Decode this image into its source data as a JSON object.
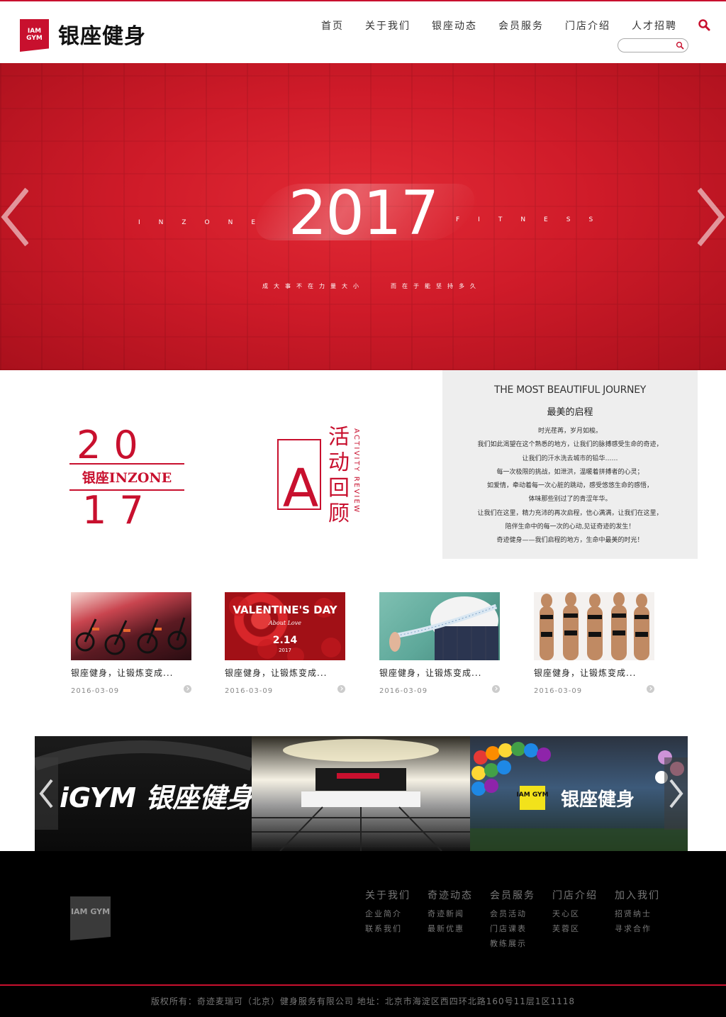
{
  "brand": {
    "name": "银座健身",
    "logo_mark": "IAM GYM",
    "accent": "#c8102e"
  },
  "nav": {
    "items": [
      "首页",
      "关于我们",
      "银座动态",
      "会员服务",
      "门店介绍",
      "人才招聘"
    ],
    "search_placeholder": ""
  },
  "banner": {
    "year": "2017",
    "left_word": "INZONE",
    "right_word": "FITNESS",
    "slogan_a": "成大事不在力量大小",
    "slogan_b": "而在于能坚持多久"
  },
  "features": {
    "logo_2017": {
      "top": "20",
      "bottom": "17",
      "label": "银座INZONE"
    },
    "activity": {
      "letter": "A",
      "chars": [
        "活",
        "动",
        "回",
        "顾"
      ],
      "vertical_en": "ACTIVITY REVIEW"
    }
  },
  "journey": {
    "title_en": "THE MOST BEAUTIFUL JOURNEY",
    "title_cn": "最美的启程",
    "lines": [
      "时光荏苒，岁月如梭。",
      "我们如此渴望在这个熟悉的地方，让我们的脉搏感受生命的奇迹，",
      "让我们的汗水洗去城市的铅华……",
      "每一次极限的挑战，如泄洪，温暖着拼搏者的心灵；",
      "如爱情，牵动着每一次心脏的跳动，感受悠悠生命的感悟，",
      "体味那些别过了的青涩年华。",
      "让我们在这里，精力充沛的再次启程，信心满满，让我们在这里，",
      "陪伴生命中的每一次的心动,见证奇迹的发生！",
      "奇迹健身——我们启程的地方，生命中最美的时光！"
    ]
  },
  "news": [
    {
      "title": "银座健身，让锻炼变成...",
      "date": "2016-03-09",
      "image": "spin-bikes"
    },
    {
      "title": "银座健身，让锻炼变成...",
      "date": "2016-03-09",
      "image": "valentines-day",
      "image_text": [
        "VALENTINE'S DAY",
        "About Love",
        "2.14",
        "2017"
      ]
    },
    {
      "title": "银座健身，让锻炼变成...",
      "date": "2016-03-09",
      "image": "tape-measure"
    },
    {
      "title": "银座健身，让锻炼变成...",
      "date": "2016-03-09",
      "image": "bikini-models"
    }
  ],
  "gallery": {
    "items": [
      {
        "image": "gym-sign-dark",
        "text": "iGYM 银座健身"
      },
      {
        "image": "gym-lobby",
        "text": ""
      },
      {
        "image": "gym-balloons",
        "text": "银座健身",
        "mark": "IAM GYM"
      }
    ]
  },
  "footer": {
    "logo_mark": "IAM GYM",
    "columns": [
      {
        "title": "关于我们",
        "links": [
          "企业简介",
          "联系我们"
        ]
      },
      {
        "title": "奇迹动态",
        "links": [
          "奇迹新闻",
          "最新优惠"
        ]
      },
      {
        "title": "会员服务",
        "links": [
          "会员活动",
          "门店课表",
          "教练展示"
        ]
      },
      {
        "title": "门店介绍",
        "links": [
          "天心区",
          "芙蓉区"
        ]
      },
      {
        "title": "加入我们",
        "links": [
          "招贤纳士",
          "寻求合作"
        ]
      }
    ],
    "copyright": "版权所有：奇迹麦瑞可（北京）健身服务有限公司   地址：北京市海淀区西四环北路160号11层1区1118"
  }
}
